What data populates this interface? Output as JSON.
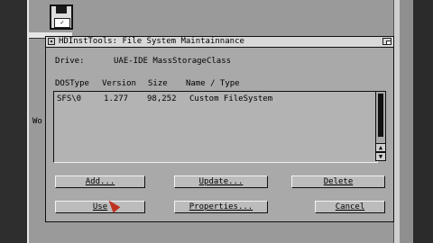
{
  "background": {
    "fragment_text": "Wo"
  },
  "window": {
    "title": "HDInstTools: File System Maintainnance",
    "drive_label": "Drive:",
    "drive_value": "UAE-IDE MassStorageClass"
  },
  "list": {
    "headers": [
      "DOSType",
      "Version",
      "Size",
      "Name / Type"
    ],
    "rows": [
      [
        "SFS\\0",
        "1.277",
        "98,252",
        "Custom FileSystem"
      ]
    ]
  },
  "buttons": {
    "add": "Add...",
    "update": "Update...",
    "delete": "Delete",
    "use": "Use",
    "properties": "Properties...",
    "cancel": "Cancel"
  },
  "colors": {
    "window_bg": "#a9a9a9",
    "pointer": "#c0301f"
  },
  "icons": {
    "disk": "floppy-disk-icon",
    "scroll_up": "arrow-up-icon",
    "scroll_down": "arrow-down-icon",
    "close": "close-gadget-icon",
    "depth": "depth-gadget-icon",
    "pointer": "mouse-pointer-icon"
  }
}
